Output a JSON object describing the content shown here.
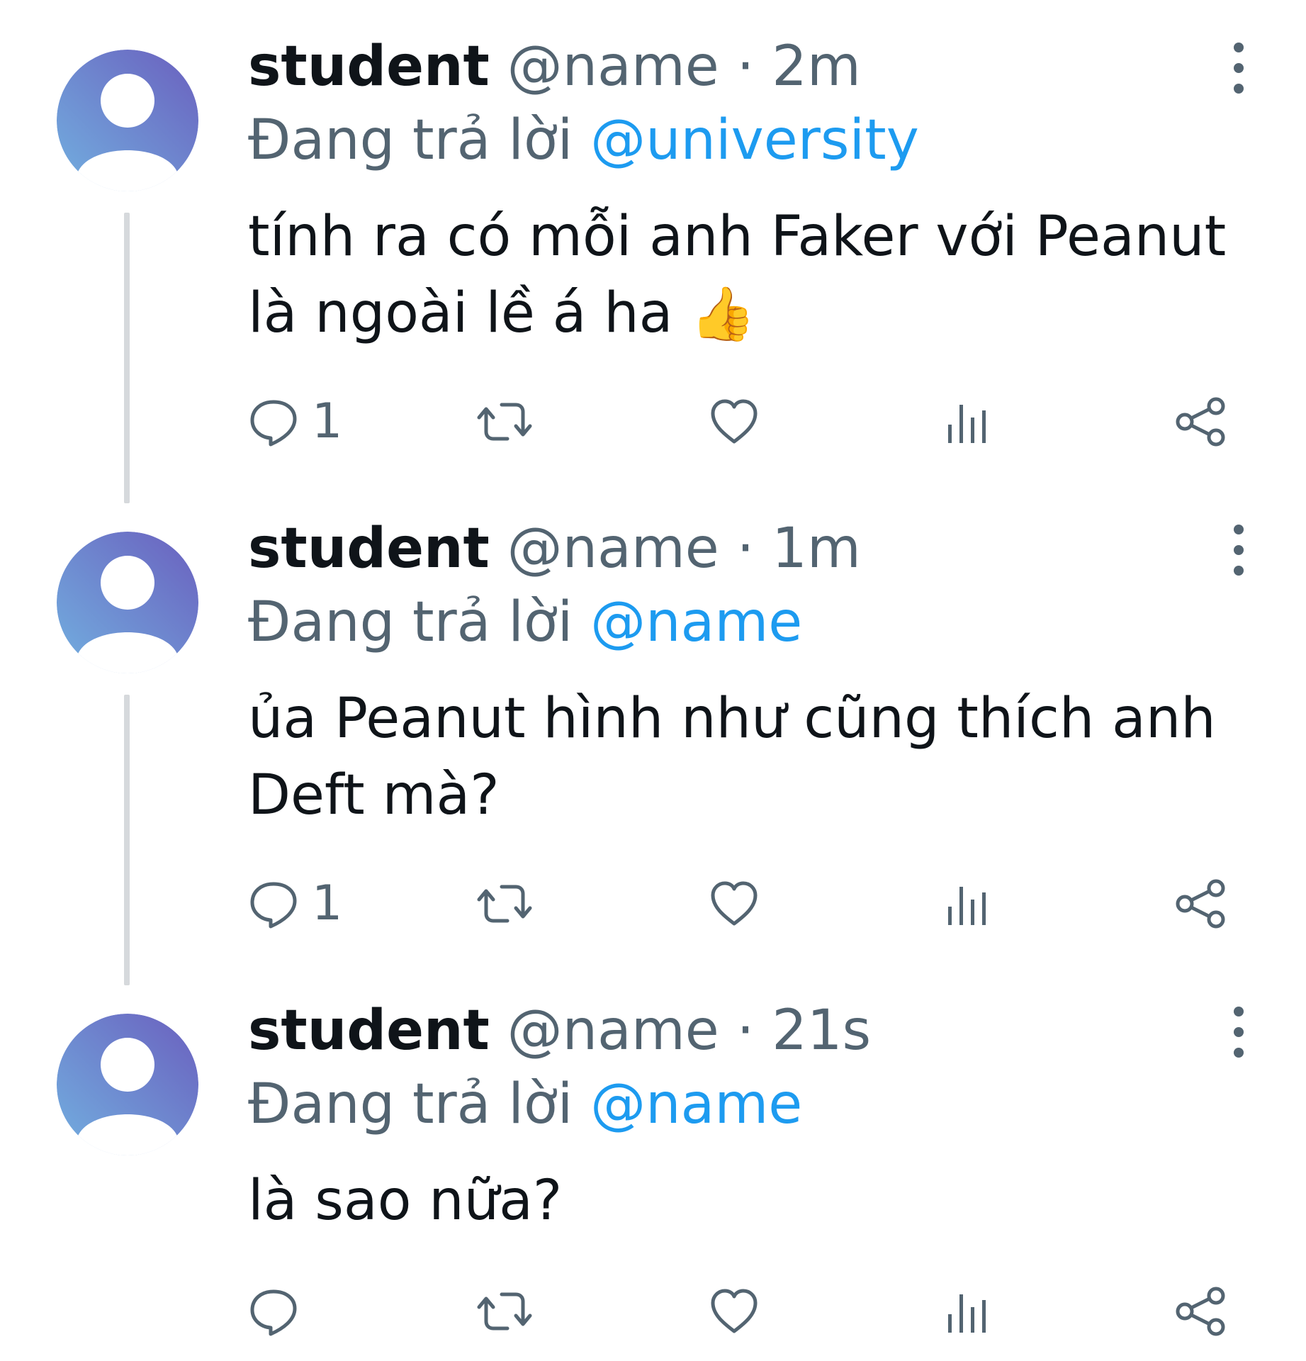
{
  "colors": {
    "text": "#0f1419",
    "secondary": "#536471",
    "accent": "#1d9bf0",
    "avatar_gradient": [
      "#6fa8dc",
      "#6c64c0"
    ]
  },
  "tweets": [
    {
      "name": "student",
      "handle": "@name",
      "separator": "·",
      "time": "2m",
      "reply_prefix": "Đang trả lời",
      "reply_to": "@university",
      "text_line1": "tính ra có mỗi anh Faker với Peanut",
      "text_line2": "là ngoài lề á ha",
      "emoji": "👍",
      "reply_count": "1",
      "icons": [
        "reply-icon",
        "retweet-icon",
        "like-icon",
        "views-icon",
        "share-icon"
      ]
    },
    {
      "name": "student",
      "handle": "@name",
      "separator": "·",
      "time": "1m",
      "reply_prefix": "Đang trả lời",
      "reply_to": "@name",
      "text_line1": "ủa Peanut hình như cũng thích anh",
      "text_line2": "Deft mà?",
      "reply_count": "1",
      "icons": [
        "reply-icon",
        "retweet-icon",
        "like-icon",
        "views-icon",
        "share-icon"
      ]
    },
    {
      "name": "student",
      "handle": "@name",
      "separator": "·",
      "time": "21s",
      "reply_prefix": "Đang trả lời",
      "reply_to": "@name",
      "text_line1": "là sao nữa?",
      "icons": [
        "reply-icon",
        "retweet-icon",
        "like-icon",
        "views-icon",
        "share-icon"
      ]
    }
  ]
}
